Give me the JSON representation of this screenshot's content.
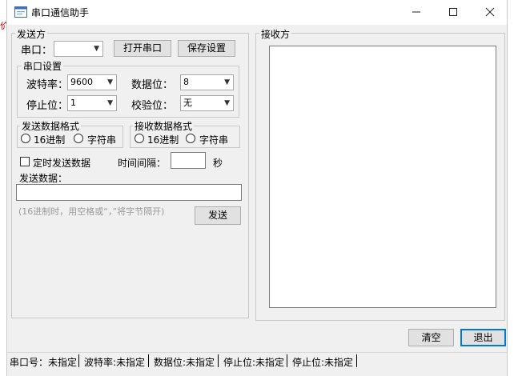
{
  "window": {
    "title": "串口通信助手"
  },
  "send_group": {
    "legend": "发送方",
    "port_label": "串口：",
    "port_value": "",
    "open_port_button": "打开串口",
    "save_settings_button": "保存设置"
  },
  "port_settings": {
    "legend": "串口设置",
    "baud_label": "波特率：",
    "baud_value": "9600",
    "databits_label": "数据位：",
    "databits_value": "8",
    "stopbits_label": "停止位：",
    "stopbits_value": "1",
    "parity_label": "校验位：",
    "parity_value": "无"
  },
  "send_format": {
    "legend": "发送数据格式",
    "hex_label": "16进制",
    "string_label": "字符串"
  },
  "recv_format": {
    "legend": "接收数据格式",
    "hex_label": "16进制",
    "string_label": "字符串"
  },
  "timed": {
    "label": "定时发送数据",
    "interval_label": "时间间隔：",
    "interval_value": "",
    "unit": "秒"
  },
  "send_data": {
    "label": "发送数据：",
    "value": "",
    "hint": "(16进制时，用空格或“，”将字节隔开)",
    "send_button": "发送"
  },
  "receive_group": {
    "legend": "接收方",
    "content": ""
  },
  "bottom": {
    "clear_button": "清空",
    "exit_button": "退出"
  },
  "status": [
    "串口号：未指定",
    "波特率:未指定",
    "数据位:未指定",
    "停止位:未指定",
    "停止位:未指定"
  ],
  "colors": {
    "accent": "#0078d7",
    "background": "#f0f0f0"
  }
}
